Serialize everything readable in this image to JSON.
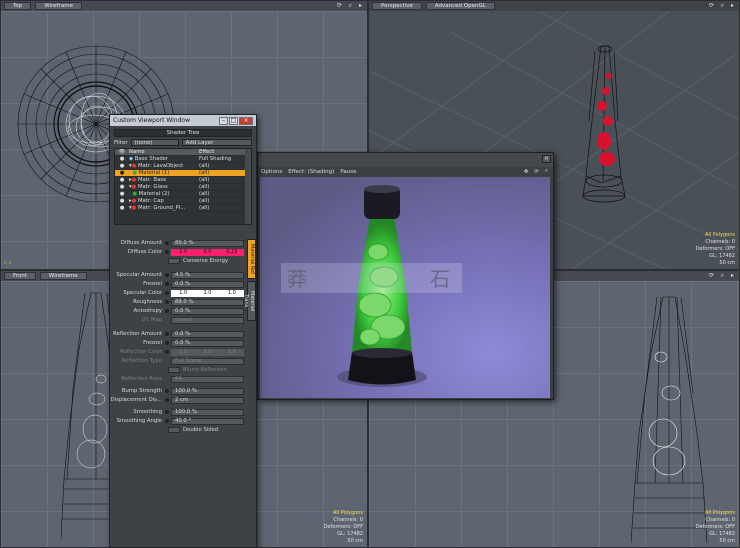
{
  "viewports": {
    "top_left": {
      "tabs": [
        "Top",
        "Wireframe"
      ]
    },
    "top_right": {
      "tabs": [
        "Perspective",
        "Advanced OpenGL"
      ],
      "info": [
        "All Polygons",
        "Channels: 0",
        "Deformers: OFF",
        "GL: 17482",
        "50 cm"
      ]
    },
    "bottom_left": {
      "tabs": [
        "Front",
        "Wireframe"
      ],
      "info": [
        "All Polygons",
        "Channels: 0",
        "Deformers: OFF",
        "GL: 17482",
        "50 cm"
      ]
    },
    "bottom_right": {
      "info": [
        "All Polygons",
        "Channels: 0",
        "Deformers: OFF",
        "GL: 17482",
        "50 cm"
      ]
    }
  },
  "tool_window": {
    "title": "Custom Viewport Window",
    "shader_tree": "Shader Tree",
    "filter_label": "Filter",
    "filter_value": "(none)",
    "add_layer": "Add Layer",
    "columns": [
      "Name",
      "Effect"
    ],
    "rows": [
      {
        "name": "Base Shader",
        "effect": "Full Shading"
      },
      {
        "name": "Matr: LavaObject",
        "effect": "(all)"
      },
      {
        "name": "Material (1)",
        "effect": "(all)"
      },
      {
        "name": "Matr: Base",
        "effect": "(all)"
      },
      {
        "name": "Matr: Glass",
        "effect": "(all)"
      },
      {
        "name": "Material (2)",
        "effect": "(all)"
      },
      {
        "name": "Matr: Cap",
        "effect": "(all)"
      },
      {
        "name": "Matr: Ground_Pl...",
        "effect": "(all)"
      }
    ],
    "side_tabs": [
      "Material Ref",
      "Material Trans"
    ],
    "props": {
      "diffuse_amount": {
        "label": "Diffuse Amount",
        "value": "80.0 %"
      },
      "diffuse_color": {
        "label": "Diffuse Color",
        "r": "1.0",
        "g": "0.0",
        "b": "0.23"
      },
      "conserve_energy": "Conserve Energy",
      "specular_amount": {
        "label": "Specular Amount",
        "value": "4.5 %"
      },
      "fresnel": {
        "label": "Fresnel",
        "value": "0.0 %"
      },
      "specular_color": {
        "label": "Specular Color",
        "r": "1.0",
        "g": "1.0",
        "b": "1.0"
      },
      "roughness": {
        "label": "Roughness",
        "value": "88.0 %"
      },
      "anisotropy": {
        "label": "Anisotropy",
        "value": "0.0 %"
      },
      "uv_map": {
        "label": "UV Map",
        "value": "(none)"
      },
      "reflection_amount": {
        "label": "Reflection Amount",
        "value": "0.0 %"
      },
      "reflection_fresnel": {
        "label": "Fresnel",
        "value": "0.0 %"
      },
      "reflection_color": {
        "label": "Reflection Color",
        "r": "1.0",
        "g": "1.0",
        "b": "1.0"
      },
      "reflection_type": {
        "label": "Reflection Type",
        "value": "Full Scene"
      },
      "blurry_reflection": "Blurry Reflection",
      "reflection_rays": {
        "label": "Reflection Rays",
        "value": "64"
      },
      "bump_strength": {
        "label": "Bump Strength",
        "value": "100.0 %"
      },
      "displacement": {
        "label": "Displacement Dis...",
        "value": "2 cm"
      },
      "smoothing": {
        "label": "Smoothing",
        "value": "100.0 %"
      },
      "smoothing_angle": {
        "label": "Smoothing Angle",
        "value": "40.0 °"
      },
      "double_sided": "Double Sided"
    }
  },
  "render_window": {
    "menu": [
      "Options",
      "Effect: (Shading)",
      "Pause"
    ],
    "watermark": [
      "莽",
      "石"
    ]
  },
  "colors": {
    "diffuse": "#ff1f6a",
    "selection": "#f0a323",
    "lava": "#d0102c",
    "glow": "#4ff04a"
  }
}
